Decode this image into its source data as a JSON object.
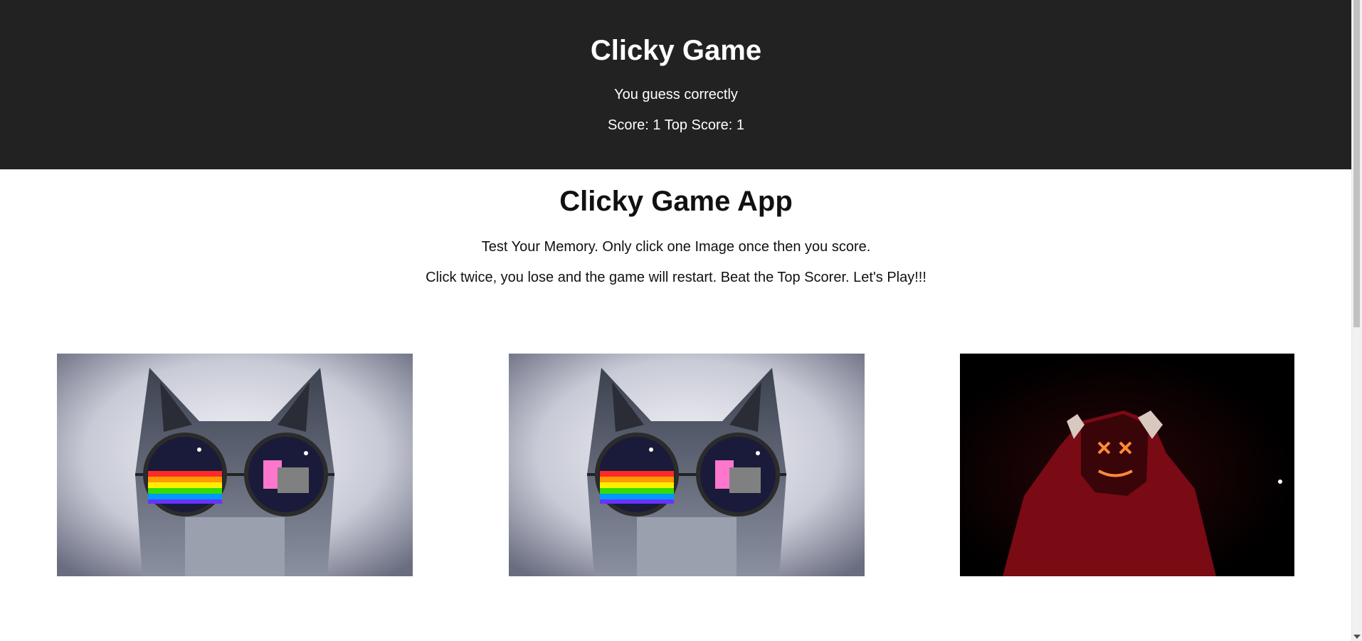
{
  "navbar": {
    "title": "Clicky Game",
    "message": "You guess correctly",
    "score_line": "Score: 1 Top Score: 1"
  },
  "jumbotron": {
    "title": "Clicky Game App",
    "line1": "Test Your Memory. Only click one Image once then you score.",
    "line2": "Click twice, you lose and the game will restart. Beat the Top Scorer. Let's Play!!!"
  },
  "cards": [
    {
      "subject": "cat with nyan-cat sunglasses"
    },
    {
      "subject": "cat with nyan-cat sunglasses"
    },
    {
      "subject": "person in red hoodie with glowing mask"
    }
  ],
  "colors": {
    "navbar_bg": "#222222",
    "text_light": "#ffffff",
    "text_dark": "#111111"
  }
}
